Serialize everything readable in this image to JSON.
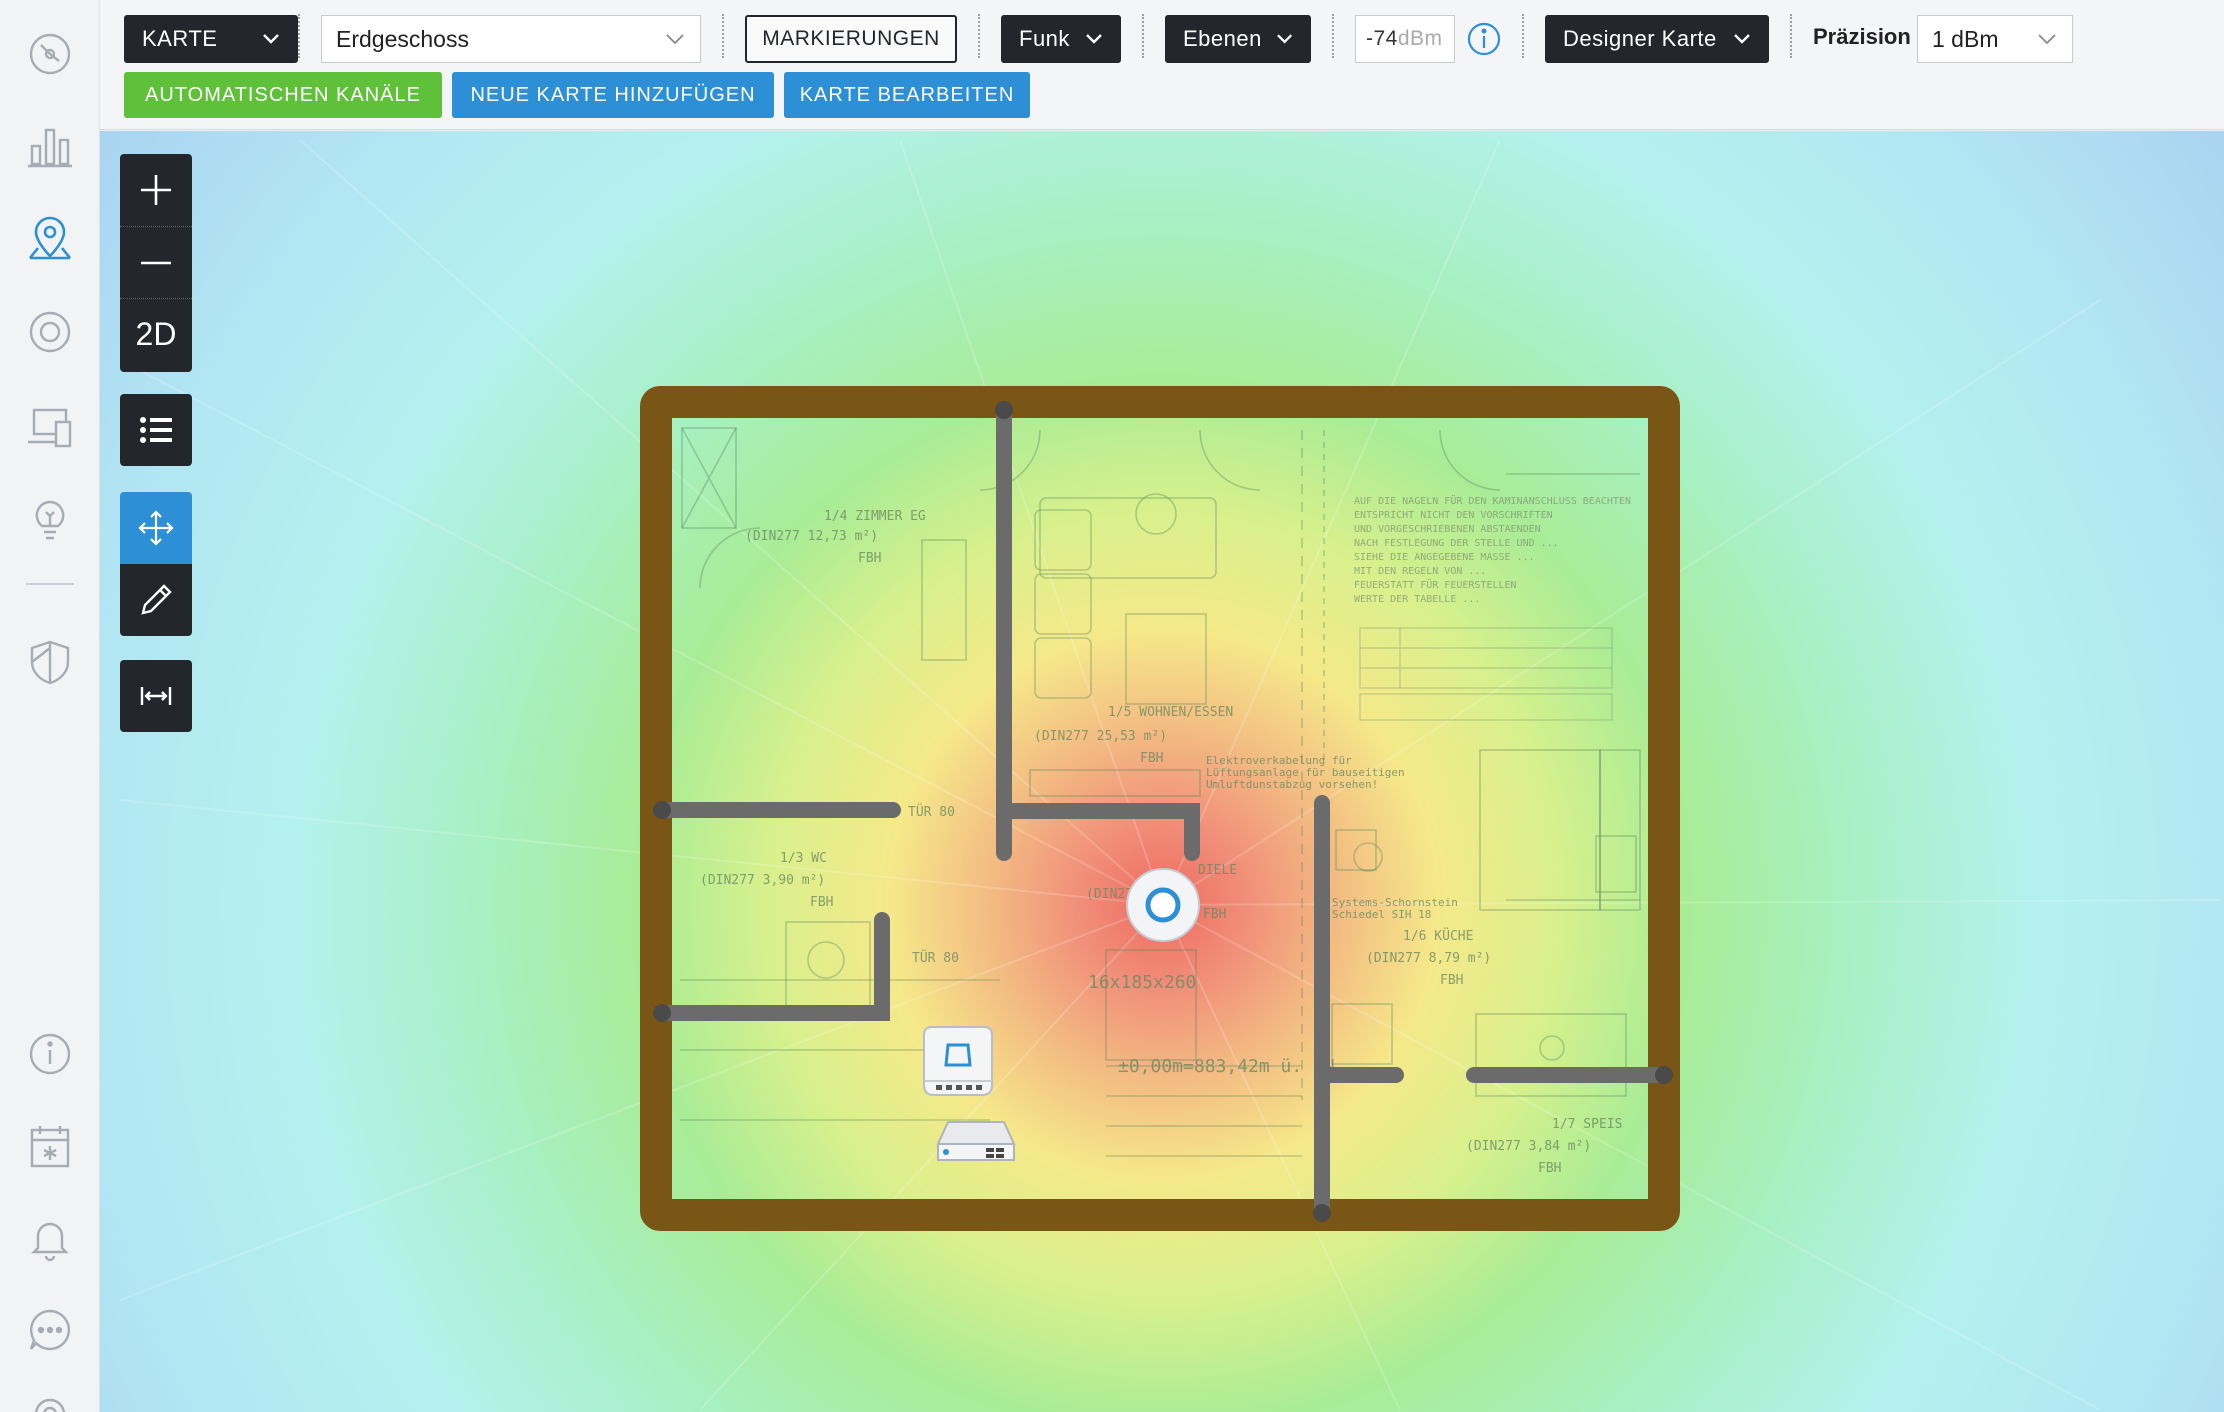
{
  "nav": {
    "icons": [
      "dashboard-icon",
      "statistics-icon",
      "map-icon",
      "devices-icon",
      "clients-icon",
      "insights-icon",
      "security-icon",
      "info-icon",
      "events-icon",
      "alerts-icon",
      "chat-icon",
      "settings-icon"
    ],
    "active": "map-icon",
    "accent": "#2d8fd5"
  },
  "topbar": {
    "view_dropdown": "KARTE",
    "floor_select": "Erdgeschoss",
    "markers_button": "MARKIERUNGEN",
    "radio_dropdown": "Funk",
    "layers_dropdown": "Ebenen",
    "dbm_value": "-74",
    "dbm_unit": "dBm",
    "map_type_dropdown": "Designer Karte",
    "precision_label": "Präzision",
    "precision_value": "1 dBm",
    "auto_channels_button": "AUTOMATISCHEN KANÄLE",
    "add_map_button": "NEUE KARTE HINZUFÜGEN",
    "edit_map_button": "KARTE BEARBEITEN"
  },
  "colors": {
    "green_button": "#5fc13a",
    "blue_button": "#2d8fd5",
    "dark": "#23272c",
    "wall_outer": "#7a5616",
    "wall_inner": "#6b6b6b"
  },
  "map_toolbar": {
    "zoom_in": "plus-icon",
    "zoom_out": "minus-icon",
    "view_mode": "2D",
    "list": "list-icon",
    "move": "move-icon",
    "draw": "pencil-icon",
    "measure": "measure-icon"
  },
  "floorplan": {
    "rooms": [
      {
        "name": "1/4 ZIMMER EG",
        "area": "(DIN277 12,73 m²)",
        "floor": "FBH"
      },
      {
        "name": "1/5 WOHNEN/ESSEN",
        "area": "(DIN277 25,53 m²)",
        "floor": "FBH"
      },
      {
        "name": "1/3 WC",
        "area": "(DIN277 3,90 m²)",
        "floor": "FBH"
      },
      {
        "name": "DIELE",
        "area": "(DIN277",
        "floor": "FBH"
      },
      {
        "name": "1/6 KÜCHE",
        "area": "(DIN277 8,79 m²)",
        "floor": "FBH"
      },
      {
        "name": "1/7 SPEIS",
        "area": "(DIN277 3,84 m²)",
        "floor": "FBH"
      }
    ],
    "annotations": [
      "16x185x260",
      "±0,00m=883,42m ü. NN",
      "TÜR 80",
      "Elektroverkabelung für Lüftungsanlage für bauseitigen Umluftdunstabzug vorsehen!",
      "Systems-Schornstein Schiedel SIH 18"
    ]
  }
}
